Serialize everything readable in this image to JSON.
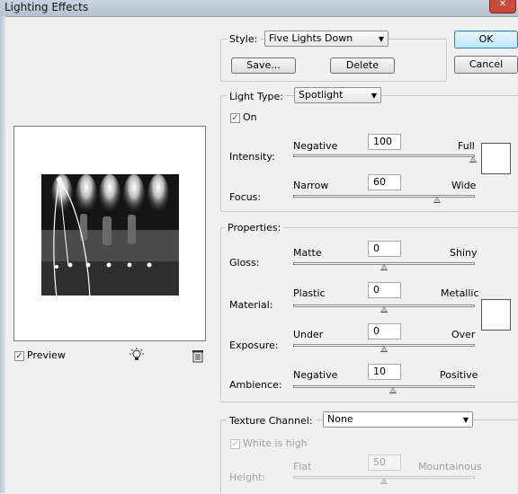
{
  "window": {
    "title": "Lighting Effects",
    "close_glyph": "✕"
  },
  "style": {
    "label": "Style:",
    "selected": "Five Lights Down",
    "save_label": "Save...",
    "delete_label": "Delete"
  },
  "buttons": {
    "ok": "OK",
    "cancel": "Cancel"
  },
  "light_type": {
    "label": "Light Type:",
    "selected": "Spotlight",
    "on_label": "On",
    "on_checked": true,
    "intensity": {
      "label": "Intensity:",
      "min_label": "Negative",
      "max_label": "Full",
      "value": "100",
      "level": 1.0
    },
    "focus": {
      "label": "Focus:",
      "min_label": "Narrow",
      "max_label": "Wide",
      "value": "60",
      "level": 0.8
    },
    "color_swatch": "#ffffff"
  },
  "properties": {
    "title": "Properties:",
    "gloss": {
      "label": "Gloss:",
      "min_label": "Matte",
      "max_label": "Shiny",
      "value": "0",
      "level": 0.5
    },
    "material": {
      "label": "Material:",
      "min_label": "Plastic",
      "max_label": "Metallic",
      "value": "0",
      "level": 0.5
    },
    "exposure": {
      "label": "Exposure:",
      "min_label": "Under",
      "max_label": "Over",
      "value": "0",
      "level": 0.5
    },
    "ambience": {
      "label": "Ambience:",
      "min_label": "Negative",
      "max_label": "Positive",
      "value": "10",
      "level": 0.55
    },
    "color_swatch": "#ffffff"
  },
  "texture": {
    "label": "Texture Channel:",
    "selected": "None",
    "white_high_label": "White is high",
    "white_high_checked": true,
    "height": {
      "label": "Height:",
      "min_label": "Flat",
      "max_label": "Mountainous",
      "value": "50",
      "level": 0.5
    }
  },
  "preview": {
    "label": "Preview",
    "checked": true,
    "icons": [
      "light-bulb-icon",
      "trash-icon"
    ]
  }
}
